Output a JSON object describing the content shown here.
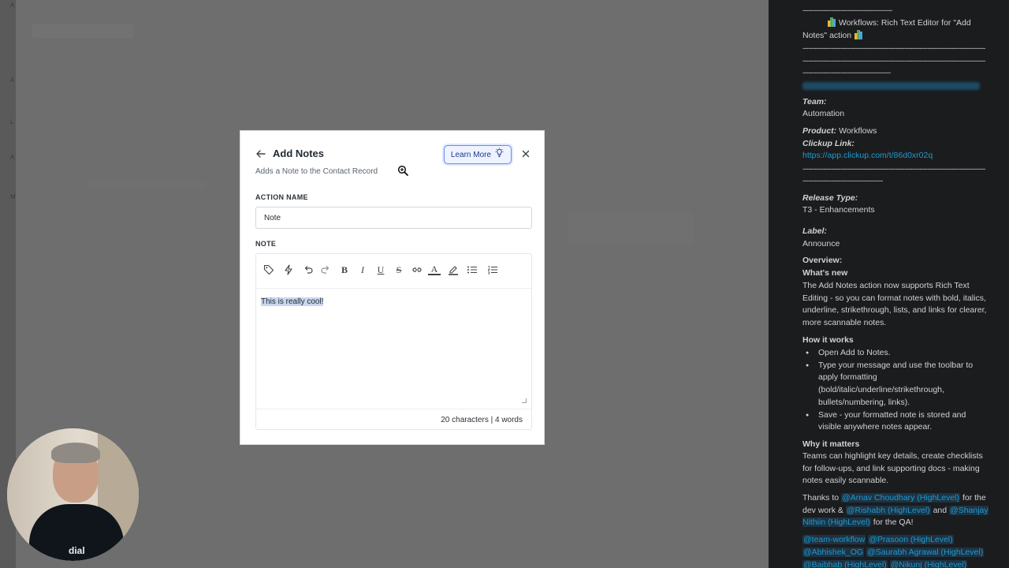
{
  "background": {
    "ghost_letters": [
      "A",
      "A",
      "L",
      "A",
      "E",
      "U",
      "M"
    ]
  },
  "modal": {
    "title": "Add Notes",
    "subtitle": "Adds a Note to the Contact Record",
    "learn_more_label": "Learn More",
    "action_name_label": "ACTION NAME",
    "action_name_value": "Note",
    "note_label": "NOTE",
    "toolbar": [
      {
        "name": "tag-icon"
      },
      {
        "name": "lightning-icon"
      },
      {
        "name": "undo-icon"
      },
      {
        "name": "redo-icon"
      },
      {
        "name": "bold-icon",
        "text": "B"
      },
      {
        "name": "italic-icon",
        "text": "I"
      },
      {
        "name": "underline-icon",
        "text": "U"
      },
      {
        "name": "strikethrough-icon",
        "text": "S"
      },
      {
        "name": "link-icon"
      },
      {
        "name": "text-color-icon",
        "text": "A"
      },
      {
        "name": "highlighter-icon"
      },
      {
        "name": "bullet-list-icon"
      },
      {
        "name": "numbered-list-icon"
      }
    ],
    "note_text": "This is really cool!",
    "char_count": "20 characters | 4 words",
    "accent_color": "#6b8de3",
    "selection_color": "#c9d6ee"
  },
  "webcam": {
    "logo_text": "dial"
  },
  "panel": {
    "title": "Workflows: Rich Text Editor for \"Add Notes\" action",
    "team_label": "Team:",
    "team_value": "Automation",
    "product_label": "Product:",
    "product_value": "Workflows",
    "clickup_label": "Clickup Link:",
    "clickup_url": "https://app.clickup.com/t/86d0xr02q",
    "release_type_label": "Release Type:",
    "release_type_value": "T3 - Enhancements",
    "label_label": "Label:",
    "label_value": "Announce",
    "overview_label": "Overview:",
    "whats_new_label": "What's new",
    "whats_new_text": "The Add Notes action now supports Rich Text Editing - so you can format notes with bold, italics, underline, strikethrough, lists, and links for clearer, more scannable notes.",
    "how_it_works_label": "How it works",
    "how_it_works_items": [
      "Open Add to Notes.",
      "Type your message and use the toolbar to apply formatting (bold/italic/underline/strikethrough, bullets/numbering, links).",
      "Save - your formatted note is stored and visible anywhere notes appear."
    ],
    "why_label": "Why it matters",
    "why_text": "Teams can highlight key details, create checklists for follow-ups, and link supporting docs - making notes easily scannable.",
    "thanks_prefix": "Thanks to",
    "mention_arnav": "@Arnav Choudhary (HighLevel)",
    "thanks_for": "for the dev work &",
    "mention_rishabh": "@Rishabh (HighLevel)",
    "thanks_and": "and",
    "mention_shanjay": "@Shanjay Nithiin (HighLevel)",
    "thanks_qa": "for the QA!",
    "cc_mentions_row1": [
      "@team-workflow",
      "@Prasoon (HighLevel)"
    ],
    "cc_mentions_row2": [
      "@Abhishek_OG",
      "@Saurabh Agrawal (HighLevel)"
    ],
    "cc_mentions_row3": [
      "@Baibhab (HighLevel)",
      "@Nikunj (HighLevel)"
    ],
    "dash_line": "--------------------------------------------------------------------------------------------------------",
    "link_color": "#1d9bd1"
  }
}
